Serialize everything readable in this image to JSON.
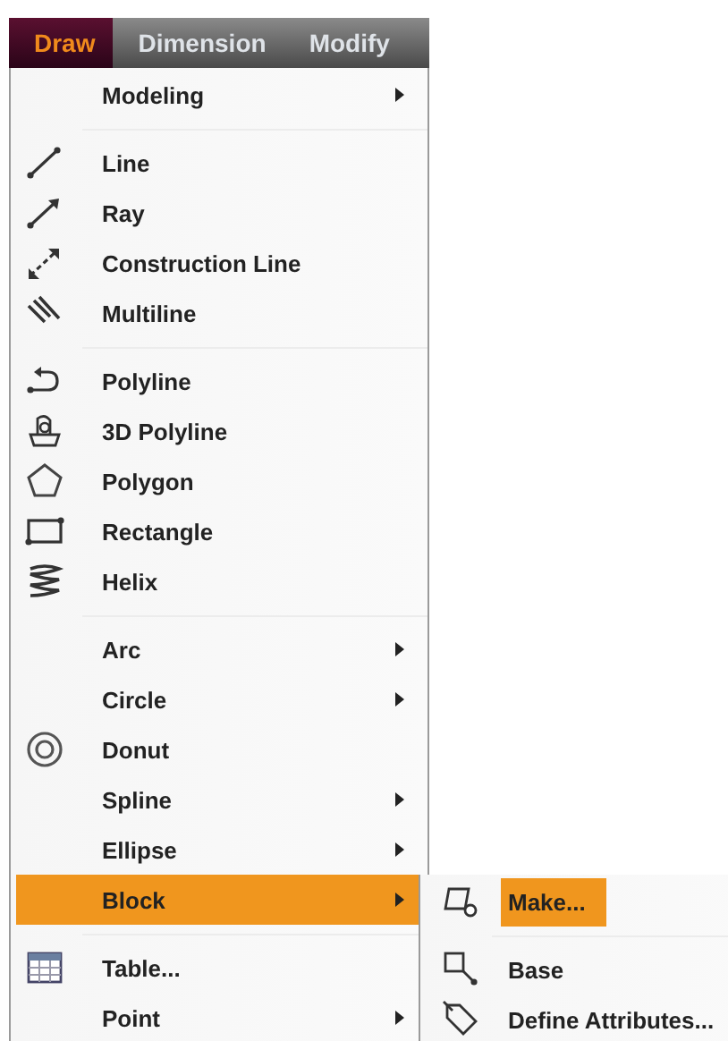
{
  "menu_bar": [
    {
      "label": "Draw",
      "selected": true
    },
    {
      "label": "Dimension",
      "selected": false
    },
    {
      "label": "Modify",
      "selected": false
    }
  ],
  "draw_menu": {
    "groups": [
      [
        {
          "label": "Modeling",
          "kind": "plain",
          "submenu": true,
          "selected": false
        }
      ],
      [
        {
          "label": "Line",
          "kind": "line",
          "submenu": false,
          "selected": false
        },
        {
          "label": "Ray",
          "kind": "ray",
          "submenu": false,
          "selected": false
        },
        {
          "label": "Construction Line",
          "kind": "xline",
          "submenu": false,
          "selected": false
        },
        {
          "label": "Multiline",
          "kind": "mline",
          "submenu": false,
          "selected": false
        }
      ],
      [
        {
          "label": "Polyline",
          "kind": "pline",
          "submenu": false,
          "selected": false
        },
        {
          "label": "3D Polyline",
          "kind": "poly3d",
          "submenu": false,
          "selected": false
        },
        {
          "label": "Polygon",
          "kind": "polygon",
          "submenu": false,
          "selected": false
        },
        {
          "label": "Rectangle",
          "kind": "rect",
          "submenu": false,
          "selected": false
        },
        {
          "label": "Helix",
          "kind": "helix",
          "submenu": false,
          "selected": false
        }
      ],
      [
        {
          "label": "Arc",
          "kind": "plain",
          "submenu": true,
          "selected": false
        },
        {
          "label": "Circle",
          "kind": "plain",
          "submenu": true,
          "selected": false
        },
        {
          "label": "Donut",
          "kind": "donut",
          "submenu": false,
          "selected": false
        },
        {
          "label": "Spline",
          "kind": "plain",
          "submenu": true,
          "selected": false
        },
        {
          "label": "Ellipse",
          "kind": "plain",
          "submenu": true,
          "selected": false
        },
        {
          "label": "Block",
          "kind": "plain",
          "submenu": true,
          "selected": true
        }
      ],
      [
        {
          "label": "Table...",
          "kind": "table",
          "submenu": false,
          "selected": false
        },
        {
          "label": "Point",
          "kind": "plain",
          "submenu": true,
          "selected": false
        }
      ]
    ]
  },
  "block_submenu": {
    "groups": [
      [
        {
          "label": "Make...",
          "kind": "make",
          "submenu": false,
          "selected": true
        }
      ],
      [
        {
          "label": "Base",
          "kind": "base",
          "submenu": false,
          "selected": false
        },
        {
          "label": "Define Attributes...",
          "kind": "attdef",
          "submenu": false,
          "selected": false
        }
      ]
    ]
  }
}
